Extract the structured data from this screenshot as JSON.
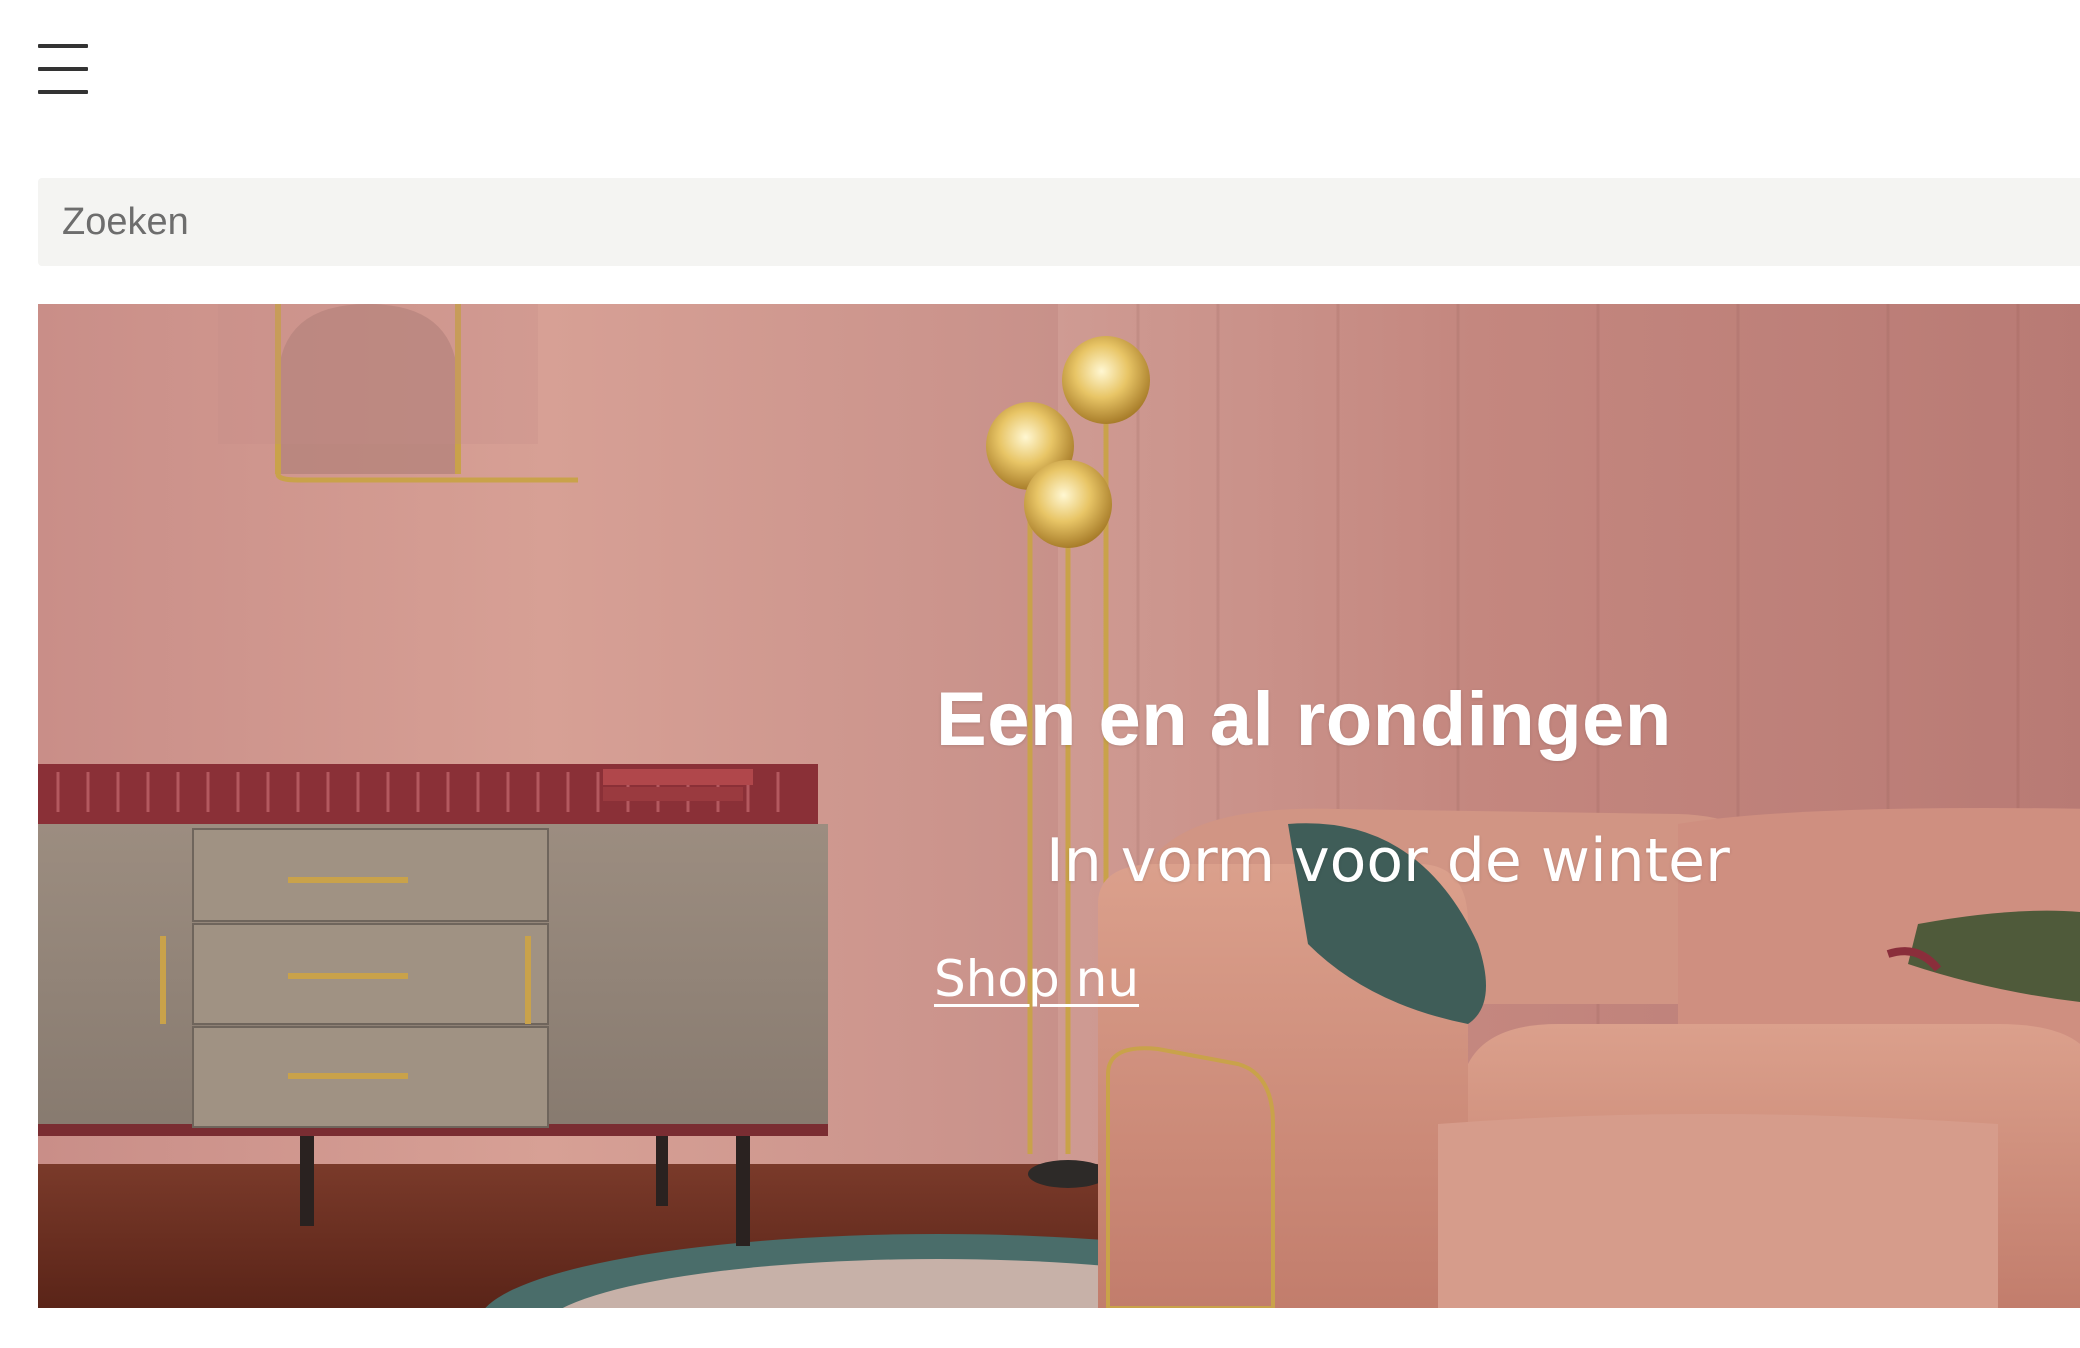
{
  "header": {
    "menu_icon": "hamburger-menu-icon"
  },
  "search": {
    "placeholder": "Zoeken",
    "value": ""
  },
  "hero": {
    "title": "Een en al rondingen",
    "subtitle": "In vorm voor de winter",
    "cta_label": "Shop nu"
  },
  "colors": {
    "hero_text": "#ffffff",
    "search_background": "#f4f4f2",
    "icon": "#333333"
  }
}
